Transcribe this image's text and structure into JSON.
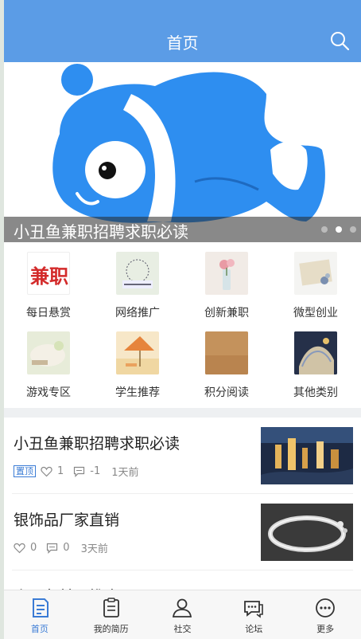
{
  "header": {
    "title": "首页",
    "search_icon": "search-icon"
  },
  "banner": {
    "caption": "小丑鱼兼职招聘求职必读",
    "dot_count": 3,
    "active_dot": 2
  },
  "categories": [
    {
      "label": "每日悬赏",
      "icon": "bounty-icon"
    },
    {
      "label": "网络推广",
      "icon": "promotion-icon"
    },
    {
      "label": "创新兼职",
      "icon": "innovation-icon"
    },
    {
      "label": "微型创业",
      "icon": "startup-icon"
    },
    {
      "label": "游戏专区",
      "icon": "game-icon"
    },
    {
      "label": "学生推荐",
      "icon": "student-icon"
    },
    {
      "label": "积分阅读",
      "icon": "reading-icon"
    },
    {
      "label": "其他类别",
      "icon": "other-icon"
    }
  ],
  "feed": [
    {
      "title": "小丑鱼兼职招聘求职必读",
      "tag": "置顶",
      "likes": "1",
      "comments": "-1",
      "time": "1天前"
    },
    {
      "title": "银饰品厂家直销",
      "likes": "0",
      "comments": "0",
      "time": "3天前"
    },
    {
      "title": "小丑鱼兼职推广员"
    }
  ],
  "tabs": [
    {
      "label": "首页",
      "icon": "home-doc-icon",
      "active": true
    },
    {
      "label": "我的简历",
      "icon": "resume-icon"
    },
    {
      "label": "社交",
      "icon": "social-person-icon"
    },
    {
      "label": "论坛",
      "icon": "forum-chat-icon"
    },
    {
      "label": "更多",
      "icon": "more-icon"
    }
  ],
  "colors": {
    "header": "#5b9ce6",
    "accent": "#3a7bd5",
    "fish": "#2e8ef0"
  }
}
